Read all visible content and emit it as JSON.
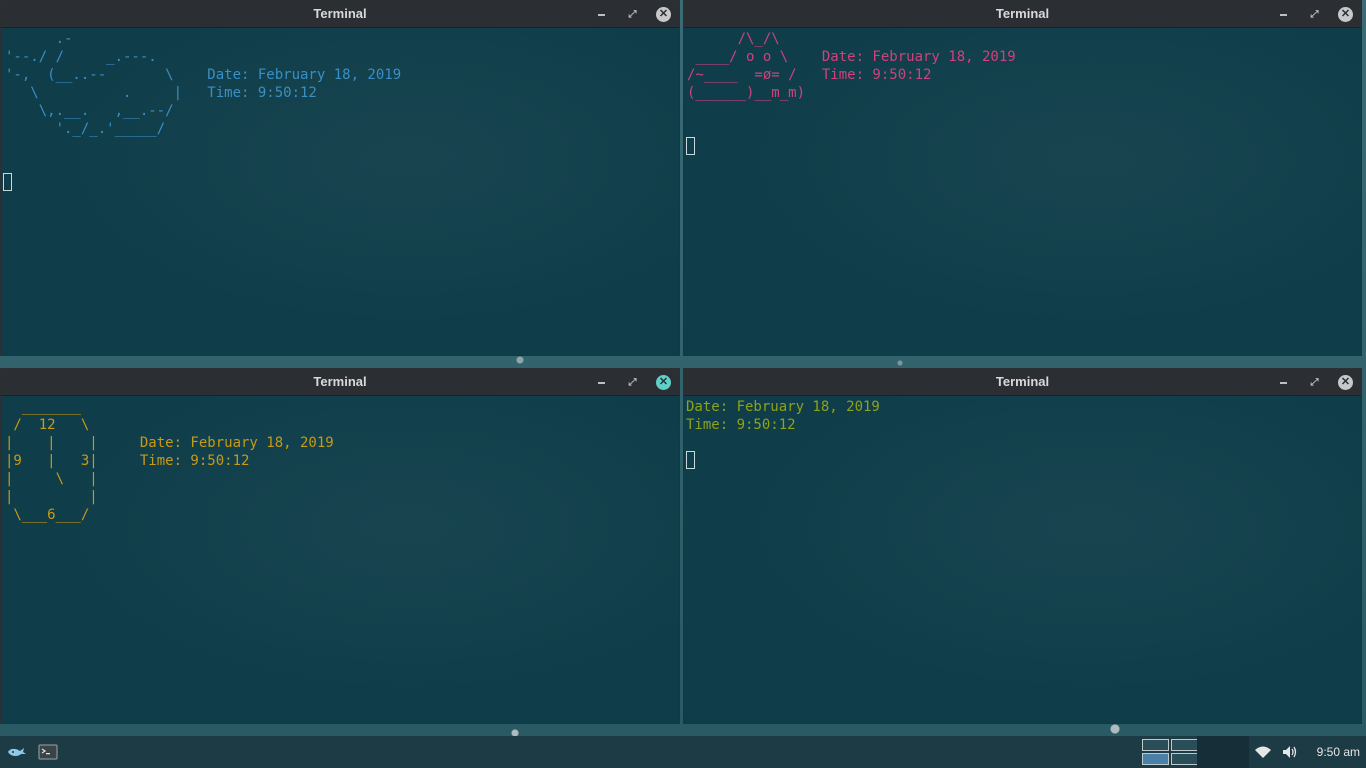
{
  "windows": [
    {
      "title": "Terminal",
      "color": "#3a8fc4",
      "lines": [
        "      .-",
        "'--./ /     _.---.",
        "'-,  (__..--       \\    Date: February 18, 2019",
        "   \\          .     |   Time: 9:50:12",
        "    \\,.__.   ,__.--/",
        "      '._/_.'_____/"
      ]
    },
    {
      "title": "Terminal",
      "color": "#d0417e",
      "lines": [
        "      /\\_/\\",
        " ____/ o o \\    Date: February 18, 2019",
        "/~____  =ø= /   Time: 9:50:12",
        "(______)__m_m)"
      ]
    },
    {
      "title": "Terminal",
      "color": "#c99a14",
      "lines": [
        "  _______",
        " /  12   \\",
        "|    |    |     Date: February 18, 2019",
        "|9   |   3|     Time: 9:50:12",
        "|     \\   |",
        "|         |",
        " \\___6___/"
      ]
    },
    {
      "title": "Terminal",
      "color": "#8ea21a",
      "lines": [
        "Date: February 18, 2019",
        "Time: 9:50:12"
      ]
    }
  ],
  "controls": {
    "minimize": "–",
    "maximize": "⤢",
    "close": "✕"
  },
  "taskbar": {
    "start_icon": "whale-menu-icon",
    "terminal_icon": "terminal-app-icon",
    "wifi_icon": "wifi-icon",
    "volume_icon": "volume-icon",
    "clock": "9:50 am"
  }
}
